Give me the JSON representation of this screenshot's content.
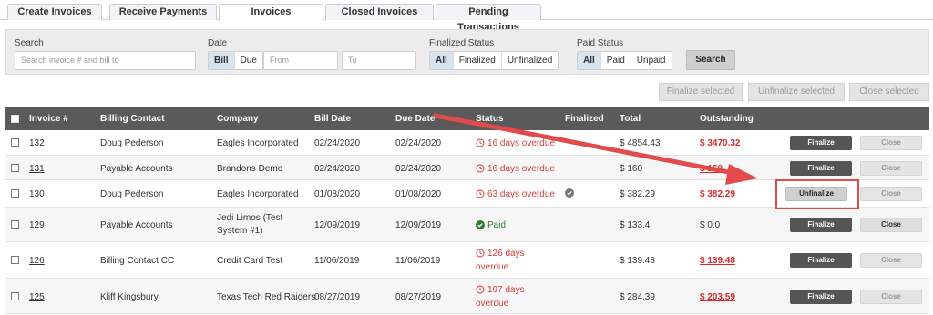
{
  "tabs": [
    {
      "label": "Create Invoices"
    },
    {
      "label": "Receive Payments"
    },
    {
      "label": "Invoices"
    },
    {
      "label": "Closed Invoices"
    },
    {
      "label": "Pending Transactions"
    }
  ],
  "filters": {
    "search_label": "Search",
    "search_placeholder": "Search invoice # and bill to",
    "date_label": "Date",
    "date_options": [
      "Bill",
      "Due"
    ],
    "from_placeholder": "From",
    "to_placeholder": "To",
    "finalized_label": "Finalized Status",
    "finalized_options": [
      "All",
      "Finalized",
      "Unfinalized"
    ],
    "paid_label": "Paid Status",
    "paid_options": [
      "All",
      "Paid",
      "Unpaid"
    ],
    "search_button": "Search"
  },
  "bulk": {
    "finalize": "Finalize selected",
    "unfinalize": "Unfinalize selected",
    "close": "Close selected"
  },
  "columns": [
    "Invoice #",
    "Billing Contact",
    "Company",
    "Bill Date",
    "Due Date",
    "Status",
    "Finalized",
    "Total",
    "Outstanding"
  ],
  "rows": [
    {
      "invoice": "132",
      "contact": "Doug Pederson",
      "company": "Eagles Incorporated",
      "bill_date": "02/24/2020",
      "due_date": "02/24/2020",
      "status": "16 days overdue",
      "total": "$ 4854.43",
      "outstanding": "$ 3470.32",
      "action": "Finalize",
      "close": "Close"
    },
    {
      "invoice": "131",
      "contact": "Payable Accounts",
      "company": "Brandons Demo",
      "bill_date": "02/24/2020",
      "due_date": "02/24/2020",
      "status": "16 days overdue",
      "total": "$ 160",
      "outstanding": "$ 160",
      "action": "Finalize",
      "close": "Close"
    },
    {
      "invoice": "130",
      "contact": "Doug Pederson",
      "company": "Eagles Incorporated",
      "bill_date": "01/08/2020",
      "due_date": "01/08/2020",
      "status": "63 days overdue",
      "total": "$ 382.29",
      "outstanding": "$ 382.29",
      "action": "Unfinalize",
      "close": "Close"
    },
    {
      "invoice": "129",
      "contact": "Payable Accounts",
      "company_line1": "Jedi Limos (Test",
      "company_line2": "System #1)",
      "bill_date": "12/09/2019",
      "due_date": "12/09/2019",
      "status": "Paid",
      "total": "$ 133.4",
      "outstanding": "$ 0.0",
      "action": "Finalize",
      "close": "Close"
    },
    {
      "invoice": "126",
      "contact": "Billing Contact CC",
      "company": "Credit Card Test",
      "bill_date": "11/06/2019",
      "due_date": "11/06/2019",
      "status_line1": "126 days",
      "status_line2": "overdue",
      "total": "$ 139.48",
      "outstanding": "$ 139.48",
      "action": "Finalize",
      "close": "Close"
    },
    {
      "invoice": "125",
      "contact": "Kliff Kingsbury",
      "company": "Texas Tech Red Raiders",
      "bill_date": "08/27/2019",
      "due_date": "08/27/2019",
      "status_line1": "197 days",
      "status_line2": "overdue",
      "total": "$ 284.39",
      "outstanding": "$ 203.59",
      "action": "Finalize",
      "close": "Close"
    }
  ],
  "colors": {
    "overdue": "#d23b3b",
    "paid": "#2e7d32",
    "header": "#5a5a5a",
    "annotation": "#e14b4b"
  }
}
